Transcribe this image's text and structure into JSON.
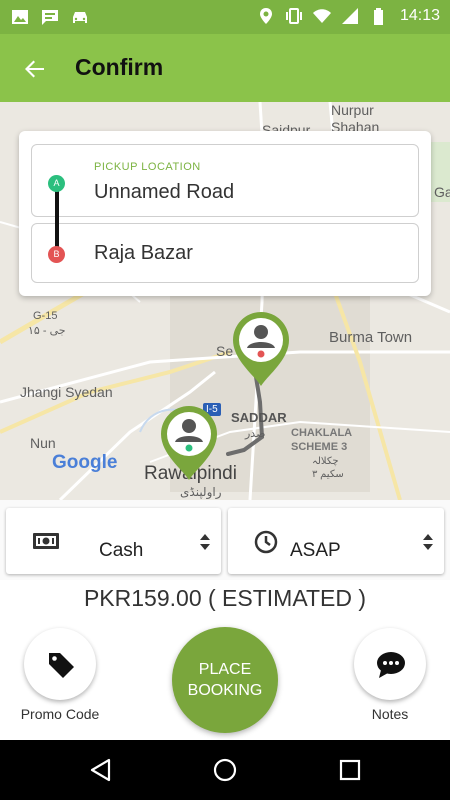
{
  "status_bar": {
    "time": "14:13",
    "left_icons": [
      "image-icon",
      "message-icon",
      "taxi-icon"
    ],
    "right_icons": [
      "location-icon",
      "vibrate-icon",
      "wifi-icon",
      "signal-icon",
      "battery-icon"
    ]
  },
  "header": {
    "title": "Confirm",
    "back_icon": "arrow-back-icon"
  },
  "map": {
    "labels": {
      "nurpur": "Nurpur",
      "shahan": "Shahan",
      "saidpur": "Saidpur",
      "burma_town": "Burma Town",
      "g15": "G-15",
      "g15_urdu": "جی - ۱۵",
      "jhangi_syedan": "Jhangi Syedan",
      "se": "Se",
      "saddar": "SADDAR",
      "saddar_urdu": "صدر",
      "chaklala_1": "CHAKLALA",
      "chaklala_2": "SCHEME 3",
      "chaklala_urdu_1": "چکلالہ",
      "chaklala_urdu_2": "سکیم ۳",
      "nun": "Nun",
      "rawalpindi": "Rawalpindi",
      "rawalpindi_urdu": "راولپنڈی",
      "i5": "I-5",
      "ga": "Ga",
      "google": "Google"
    }
  },
  "route": {
    "pickup_caption": "PICKUP LOCATION",
    "pickup_value": "Unnamed Road",
    "drop_value": "Raja Bazar",
    "marker_a": "A",
    "marker_b": "B"
  },
  "options": {
    "payment_label": "Cash",
    "payment_icon": "cash-icon",
    "time_label": "ASAP",
    "time_icon": "clock-icon"
  },
  "fare": {
    "text": "PKR159.00 ( ESTIMATED )"
  },
  "actions": {
    "promo_label": "Promo Code",
    "promo_icon": "tag-icon",
    "place_label": "PLACE\nBOOKING",
    "notes_label": "Notes",
    "notes_icon": "chat-icon"
  },
  "colors": {
    "status_bar": "#7cb342",
    "app_bar": "#8bc34a",
    "accent": "#7aa63c",
    "marker_a": "#2bbf7e",
    "marker_b": "#e35454"
  }
}
